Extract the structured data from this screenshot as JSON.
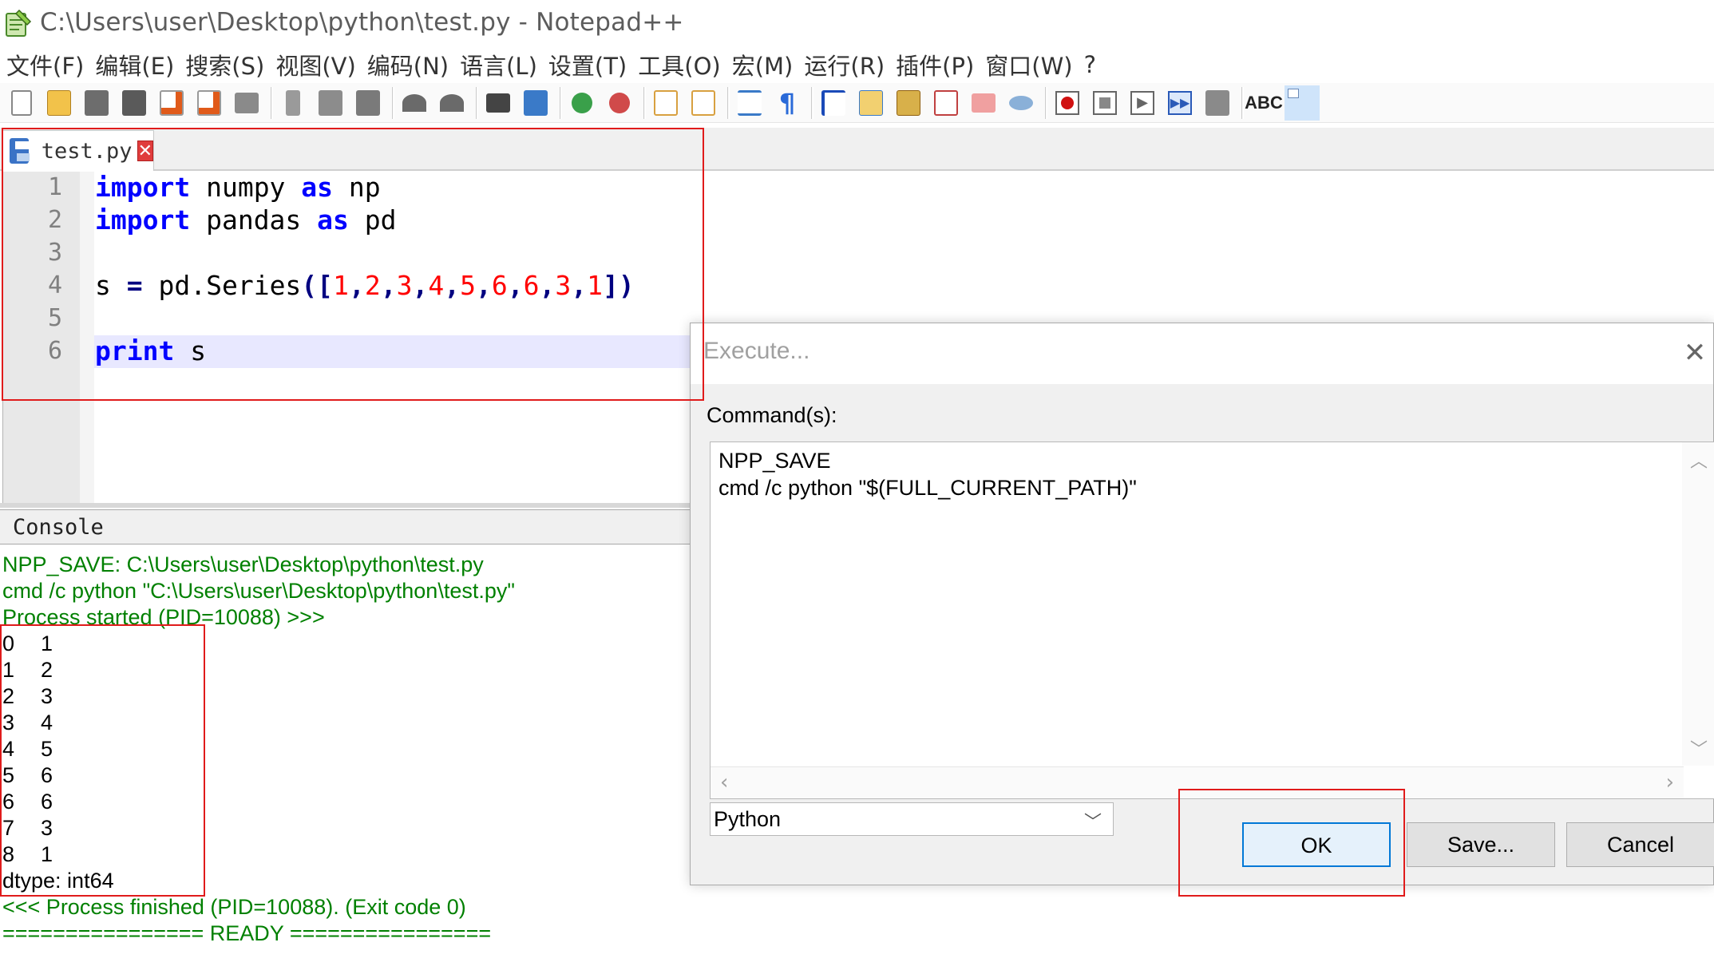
{
  "window": {
    "title": "C:\\Users\\user\\Desktop\\python\\test.py - Notepad++"
  },
  "menu": [
    "文件(F)",
    "编辑(E)",
    "搜索(S)",
    "视图(V)",
    "编码(N)",
    "语言(L)",
    "设置(T)",
    "工具(O)",
    "宏(M)",
    "运行(R)",
    "插件(P)",
    "窗口(W)",
    "?"
  ],
  "toolbar": {
    "icons": [
      "new-file-icon",
      "open-file-icon",
      "save-icon",
      "save-all-icon",
      "close-icon",
      "close-all-icon",
      "print-icon",
      "cut-icon",
      "copy-icon",
      "paste-icon",
      "undo-icon",
      "redo-icon",
      "find-icon",
      "replace-icon",
      "zoom-in-icon",
      "zoom-out-icon",
      "sync-vertical-icon",
      "sync-horizontal-icon",
      "word-wrap-icon",
      "show-all-chars-icon",
      "indent-guide-icon",
      "udl-icon",
      "doc-map-icon",
      "function-list-icon",
      "folder-workspace-icon",
      "monitoring-icon",
      "record-macro-icon",
      "stop-record-icon",
      "play-macro-icon",
      "run-macro-multiple-icon",
      "save-macro-icon",
      "spell-check-icon",
      "extra-icon"
    ],
    "spell_label": "ABC"
  },
  "editor": {
    "tab_label": "test.py",
    "lines": [
      {
        "num": "1"
      },
      {
        "num": "2"
      },
      {
        "num": "3"
      },
      {
        "num": "4"
      },
      {
        "num": "5"
      },
      {
        "num": "6"
      }
    ],
    "code": {
      "l1_kw": "import",
      "l1_mod": " numpy ",
      "l1_as": "as",
      "l1_alias": " np",
      "l2_kw": "import",
      "l2_mod": " pandas ",
      "l2_as": "as",
      "l2_alias": " pd",
      "l4_a": "s ",
      "l4_eq": "=",
      "l4_b": " pd.Series",
      "l4_open": "([",
      "l4_nums": [
        "1",
        "2",
        "3",
        "4",
        "5",
        "6",
        "6",
        "3",
        "1"
      ],
      "l4_close": "])",
      "l6_kw": "print",
      "l6_rest": " s"
    }
  },
  "console": {
    "header": "Console",
    "lines_top": [
      "NPP_SAVE: C:\\Users\\user\\Desktop\\python\\test.py",
      "cmd /c python \"C:\\Users\\user\\Desktop\\python\\test.py\"",
      "Process started (PID=10088) >>>"
    ],
    "series": [
      {
        "idx": "0",
        "val": "1"
      },
      {
        "idx": "1",
        "val": "2"
      },
      {
        "idx": "2",
        "val": "3"
      },
      {
        "idx": "3",
        "val": "4"
      },
      {
        "idx": "4",
        "val": "5"
      },
      {
        "idx": "5",
        "val": "6"
      },
      {
        "idx": "6",
        "val": "6"
      },
      {
        "idx": "7",
        "val": "3"
      },
      {
        "idx": "8",
        "val": "1"
      }
    ],
    "dtype": "dtype: int64",
    "lines_bottom": [
      "<<< Process finished (PID=10088). (Exit code 0)",
      "================ READY ================"
    ]
  },
  "dialog": {
    "title": "Execute...",
    "close_glyph": "✕",
    "commands_label": "Command(s):",
    "commands_text": "NPP_SAVE\ncmd /c python \"$(FULL_CURRENT_PATH)\"",
    "selected_script": "Python",
    "ok_label": "OK",
    "save_label": "Save...",
    "cancel_label": "Cancel"
  }
}
